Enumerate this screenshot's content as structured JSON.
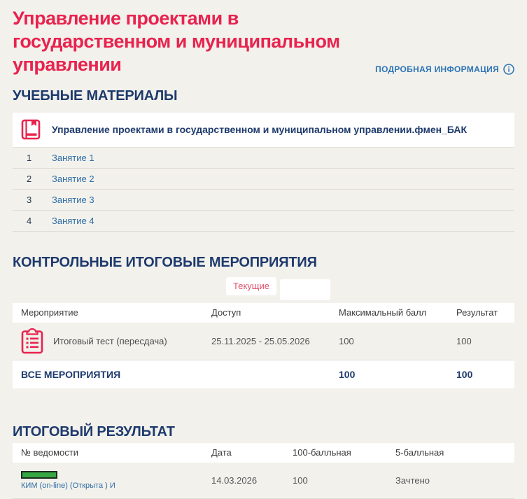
{
  "header": {
    "title": "Управление проектами в государственном и муниципальном управлении",
    "details_label": "ПОДРОБНАЯ ИНФОРМАЦИЯ"
  },
  "colors": {
    "accent_pink": "#e8234e",
    "navy": "#1e3a6d",
    "link_blue": "#2e6da4",
    "green_status": "#35a843",
    "background": "#f2f1ec"
  },
  "materials": {
    "heading": "УЧЕБНЫЕ МАТЕРИАЛЫ",
    "course_file": "Управление проектами в государственном и муниципальном управлении.фмен_БАК",
    "items": [
      {
        "num": "1",
        "label": "Занятие 1"
      },
      {
        "num": "2",
        "label": "Занятие 2"
      },
      {
        "num": "3",
        "label": "Занятие 3"
      },
      {
        "num": "4",
        "label": "Занятие 4"
      }
    ]
  },
  "control": {
    "heading": "КОНТРОЛЬНЫЕ ИТОГОВЫЕ МЕРОПРИЯТИЯ",
    "tabs": [
      {
        "label": "Текущие"
      },
      {
        "label": ""
      }
    ],
    "columns": [
      "Мероприятие",
      "Доступ",
      "Максимальный балл",
      "Результат"
    ],
    "rows": [
      {
        "name": "Итоговый тест (пересдача)",
        "access": "25.11.2025 - 25.05.2026",
        "max": "100",
        "result": "100"
      }
    ],
    "total": {
      "label": "ВСЕ МЕРОПРИЯТИЯ",
      "max": "100",
      "result": "100"
    }
  },
  "final": {
    "heading": "ИТОГОВЫЙ РЕЗУЛЬТАТ",
    "columns": [
      "№ ведомости",
      "Дата",
      "100-балльная",
      "5-балльная"
    ],
    "rows": [
      {
        "sheet": "КИМ (on-line) (Открыта ) И",
        "date": "14.03.2026",
        "score100": "100",
        "score5": "Зачтено"
      }
    ]
  }
}
